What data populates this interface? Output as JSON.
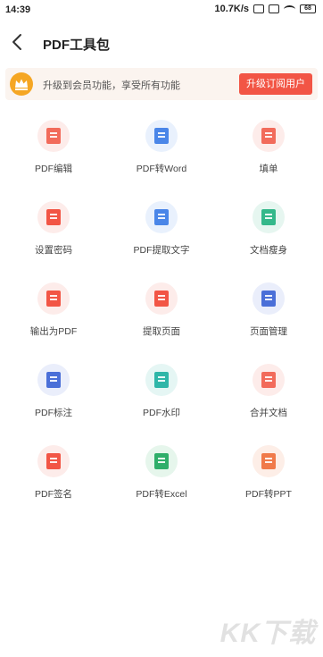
{
  "status_bar": {
    "time": "14:39",
    "network_speed": "10.7K/s",
    "battery": "68"
  },
  "header": {
    "title": "PDF工具包"
  },
  "banner": {
    "text": "升级到会员功能，享受所有功能",
    "button_label": "升级订阅用户"
  },
  "tools": [
    {
      "label": "PDF编辑",
      "icon": "pdf-edit-icon",
      "color": "#f26b5b",
      "bg": "#fdecea"
    },
    {
      "label": "PDF转Word",
      "icon": "pdf-to-word-icon",
      "color": "#4a86e8",
      "bg": "#e9f1fd"
    },
    {
      "label": "填单",
      "icon": "fill-form-icon",
      "color": "#f26b5b",
      "bg": "#fdecea"
    },
    {
      "label": "设置密码",
      "icon": "lock-icon",
      "color": "#f25545",
      "bg": "#fdecea"
    },
    {
      "label": "PDF提取文字",
      "icon": "extract-text-icon",
      "color": "#4a86e8",
      "bg": "#e9f1fd"
    },
    {
      "label": "文档瘦身",
      "icon": "compress-icon",
      "color": "#34b88a",
      "bg": "#e6f6f0"
    },
    {
      "label": "输出为PDF",
      "icon": "export-pdf-icon",
      "color": "#f25545",
      "bg": "#fdecea"
    },
    {
      "label": "提取页面",
      "icon": "extract-page-icon",
      "color": "#f25545",
      "bg": "#fdecea"
    },
    {
      "label": "页面管理",
      "icon": "page-manage-icon",
      "color": "#4a6fd8",
      "bg": "#eaeefb"
    },
    {
      "label": "PDF标注",
      "icon": "annotate-icon",
      "color": "#4a6fd8",
      "bg": "#eaeefb"
    },
    {
      "label": "PDF水印",
      "icon": "watermark-icon",
      "color": "#2fb6a8",
      "bg": "#e5f6f4"
    },
    {
      "label": "合并文档",
      "icon": "merge-icon",
      "color": "#f26b5b",
      "bg": "#fdecea"
    },
    {
      "label": "PDF签名",
      "icon": "signature-icon",
      "color": "#f25545",
      "bg": "#fdecea"
    },
    {
      "label": "PDF转Excel",
      "icon": "pdf-to-excel-icon",
      "color": "#2fae6a",
      "bg": "#e6f6ec"
    },
    {
      "label": "PDF转PPT",
      "icon": "pdf-to-ppt-icon",
      "color": "#f07a4a",
      "bg": "#fdeee7"
    }
  ],
  "watermark": "KK下载"
}
